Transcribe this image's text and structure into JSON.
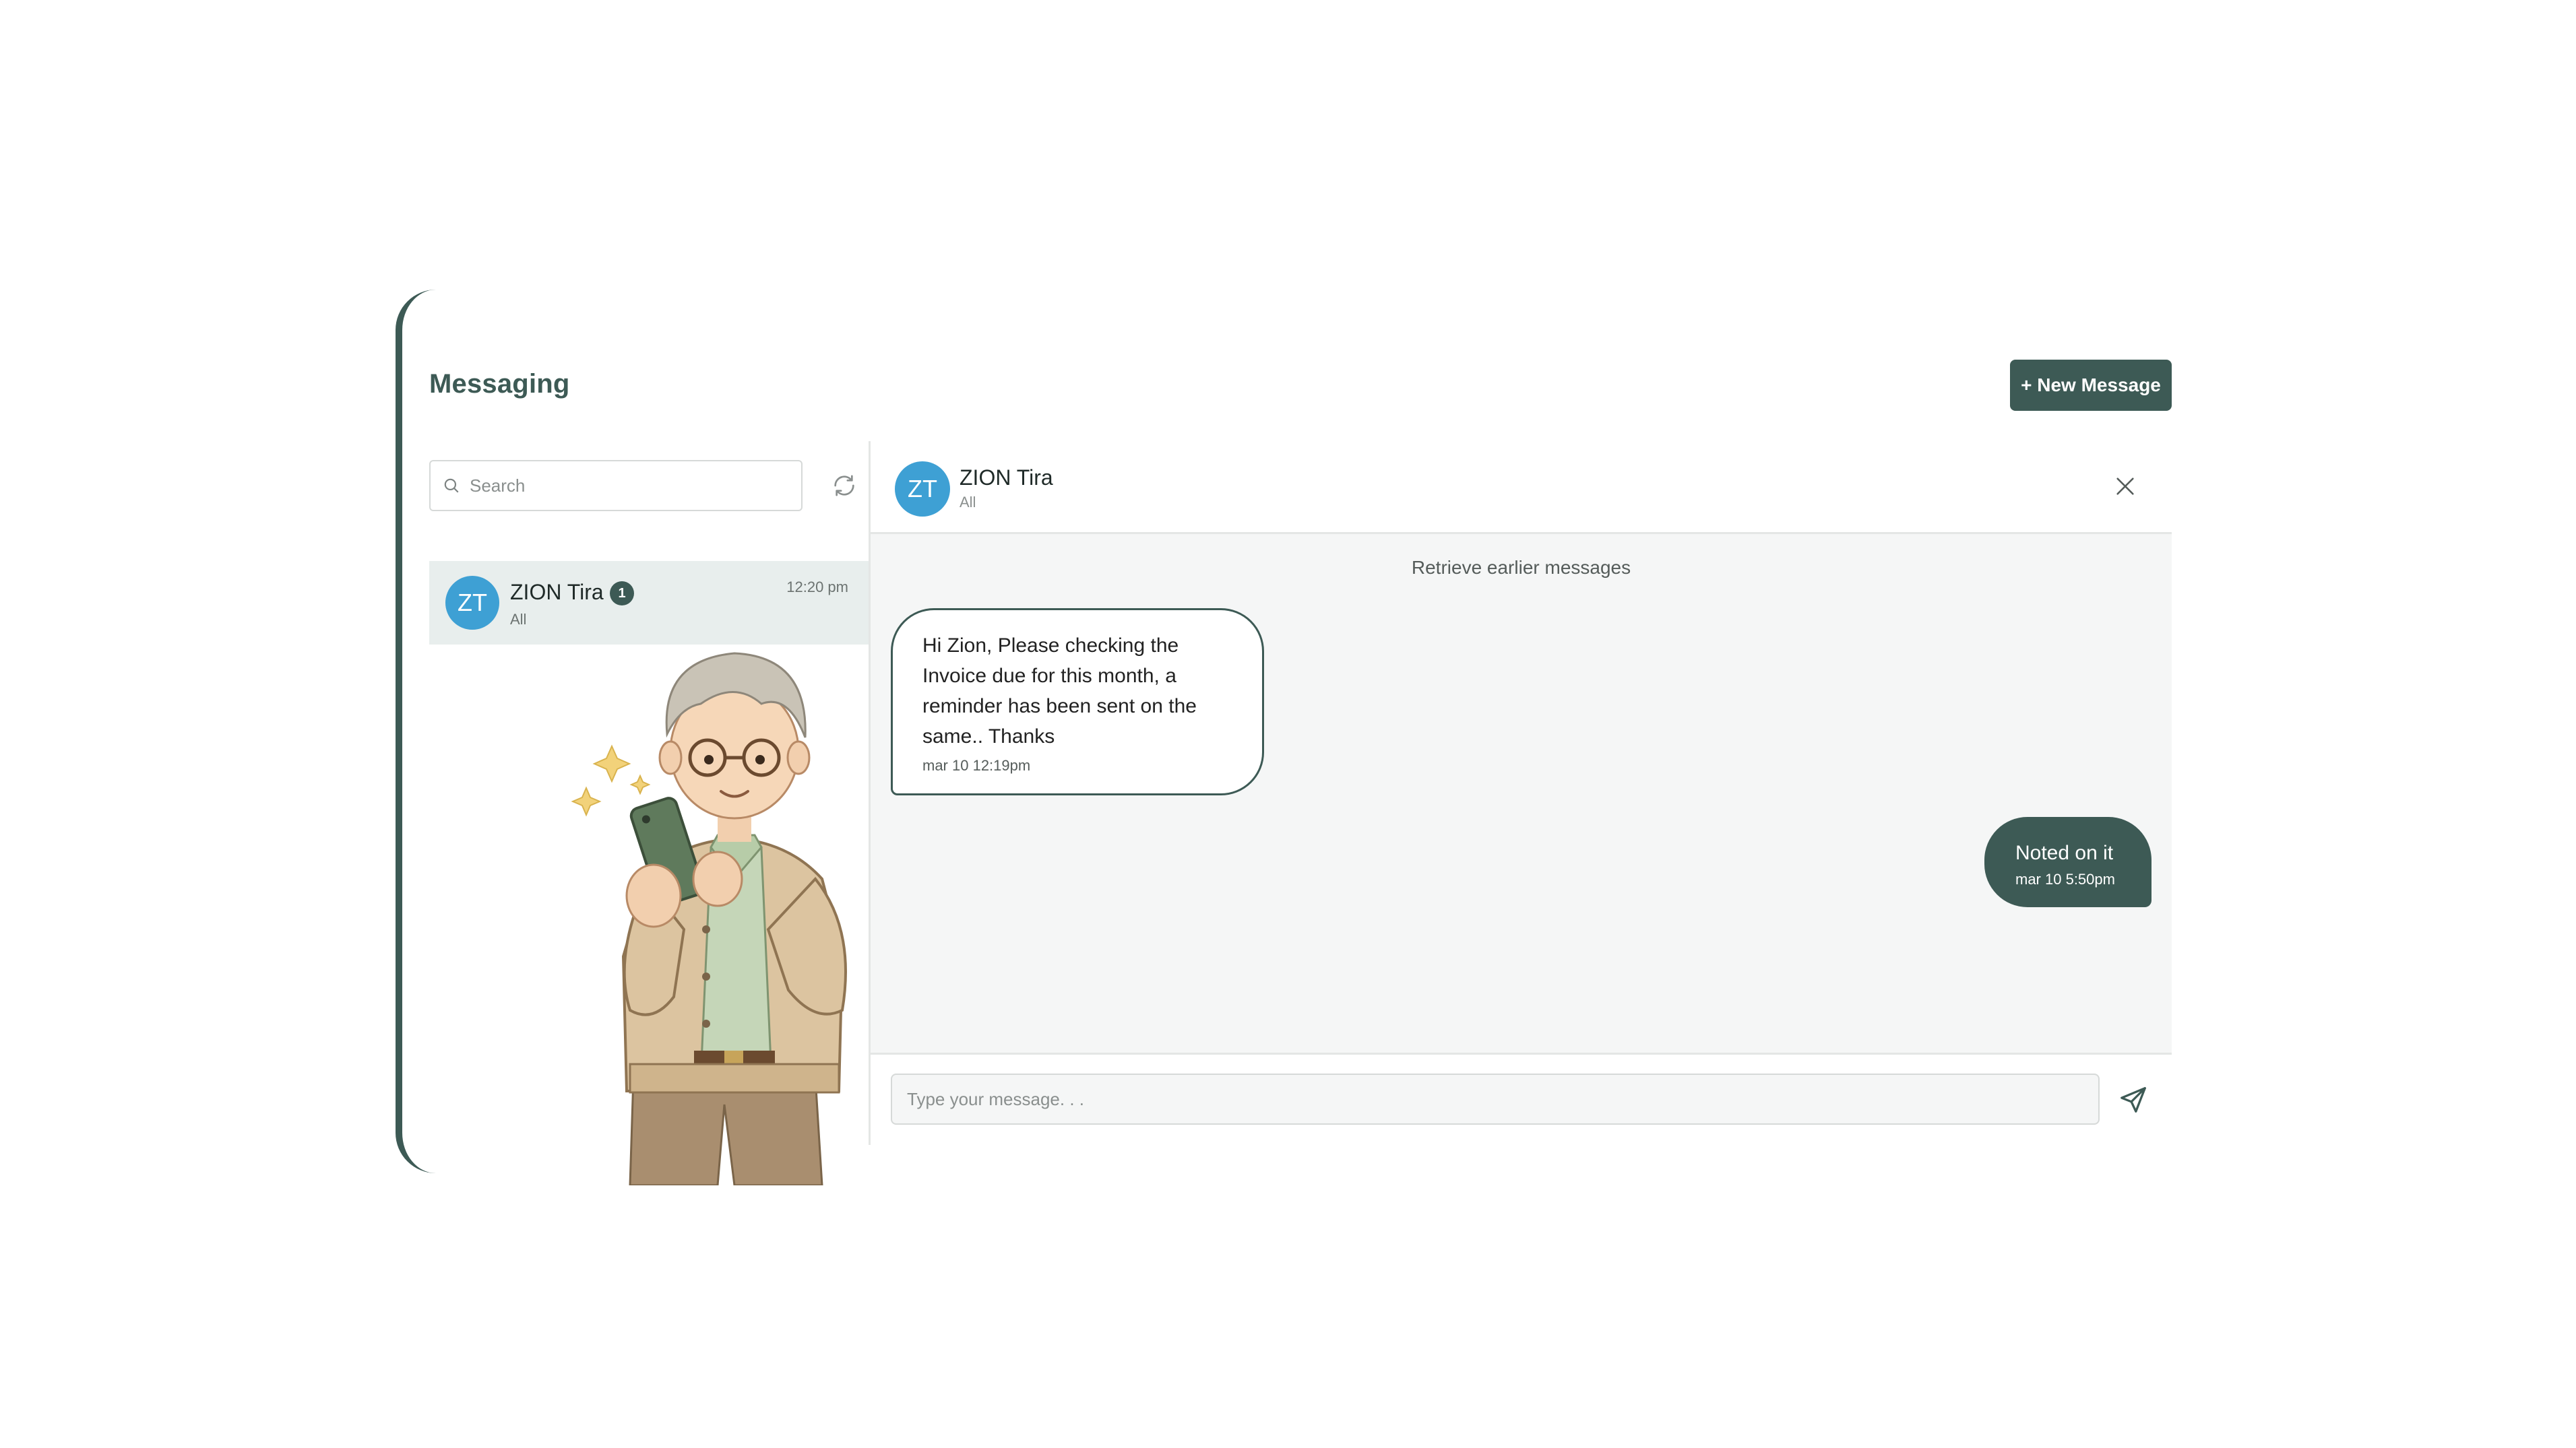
{
  "page": {
    "title": "Messaging",
    "new_message_label": "+ New Message"
  },
  "search": {
    "placeholder": "Search"
  },
  "conversations": [
    {
      "initials": "ZT",
      "name": "ZION Tira",
      "subtitle": "All",
      "unread": "1",
      "time": "12:20 pm"
    }
  ],
  "chat": {
    "initials": "ZT",
    "name": "ZION Tira",
    "subtitle": "All",
    "retrieve_label": "Retrieve earlier messages",
    "messages": [
      {
        "direction": "incoming",
        "text": "Hi Zion, Please checking the Invoice due for this month, a reminder has been sent on the same.. Thanks",
        "timestamp": "mar 10 12:19pm"
      },
      {
        "direction": "outgoing",
        "text": "Noted on it",
        "timestamp": "mar 10 5:50pm"
      }
    ],
    "composer_placeholder": "Type your message. . ."
  },
  "icons": {
    "search": "search-icon",
    "refresh": "refresh-icon",
    "close": "close-icon",
    "send": "send-icon"
  },
  "colors": {
    "accent": "#3d5a55",
    "avatar": "#3ea0d4",
    "selected_row": "#e8eeed",
    "chat_background": "#f5f6f6"
  }
}
